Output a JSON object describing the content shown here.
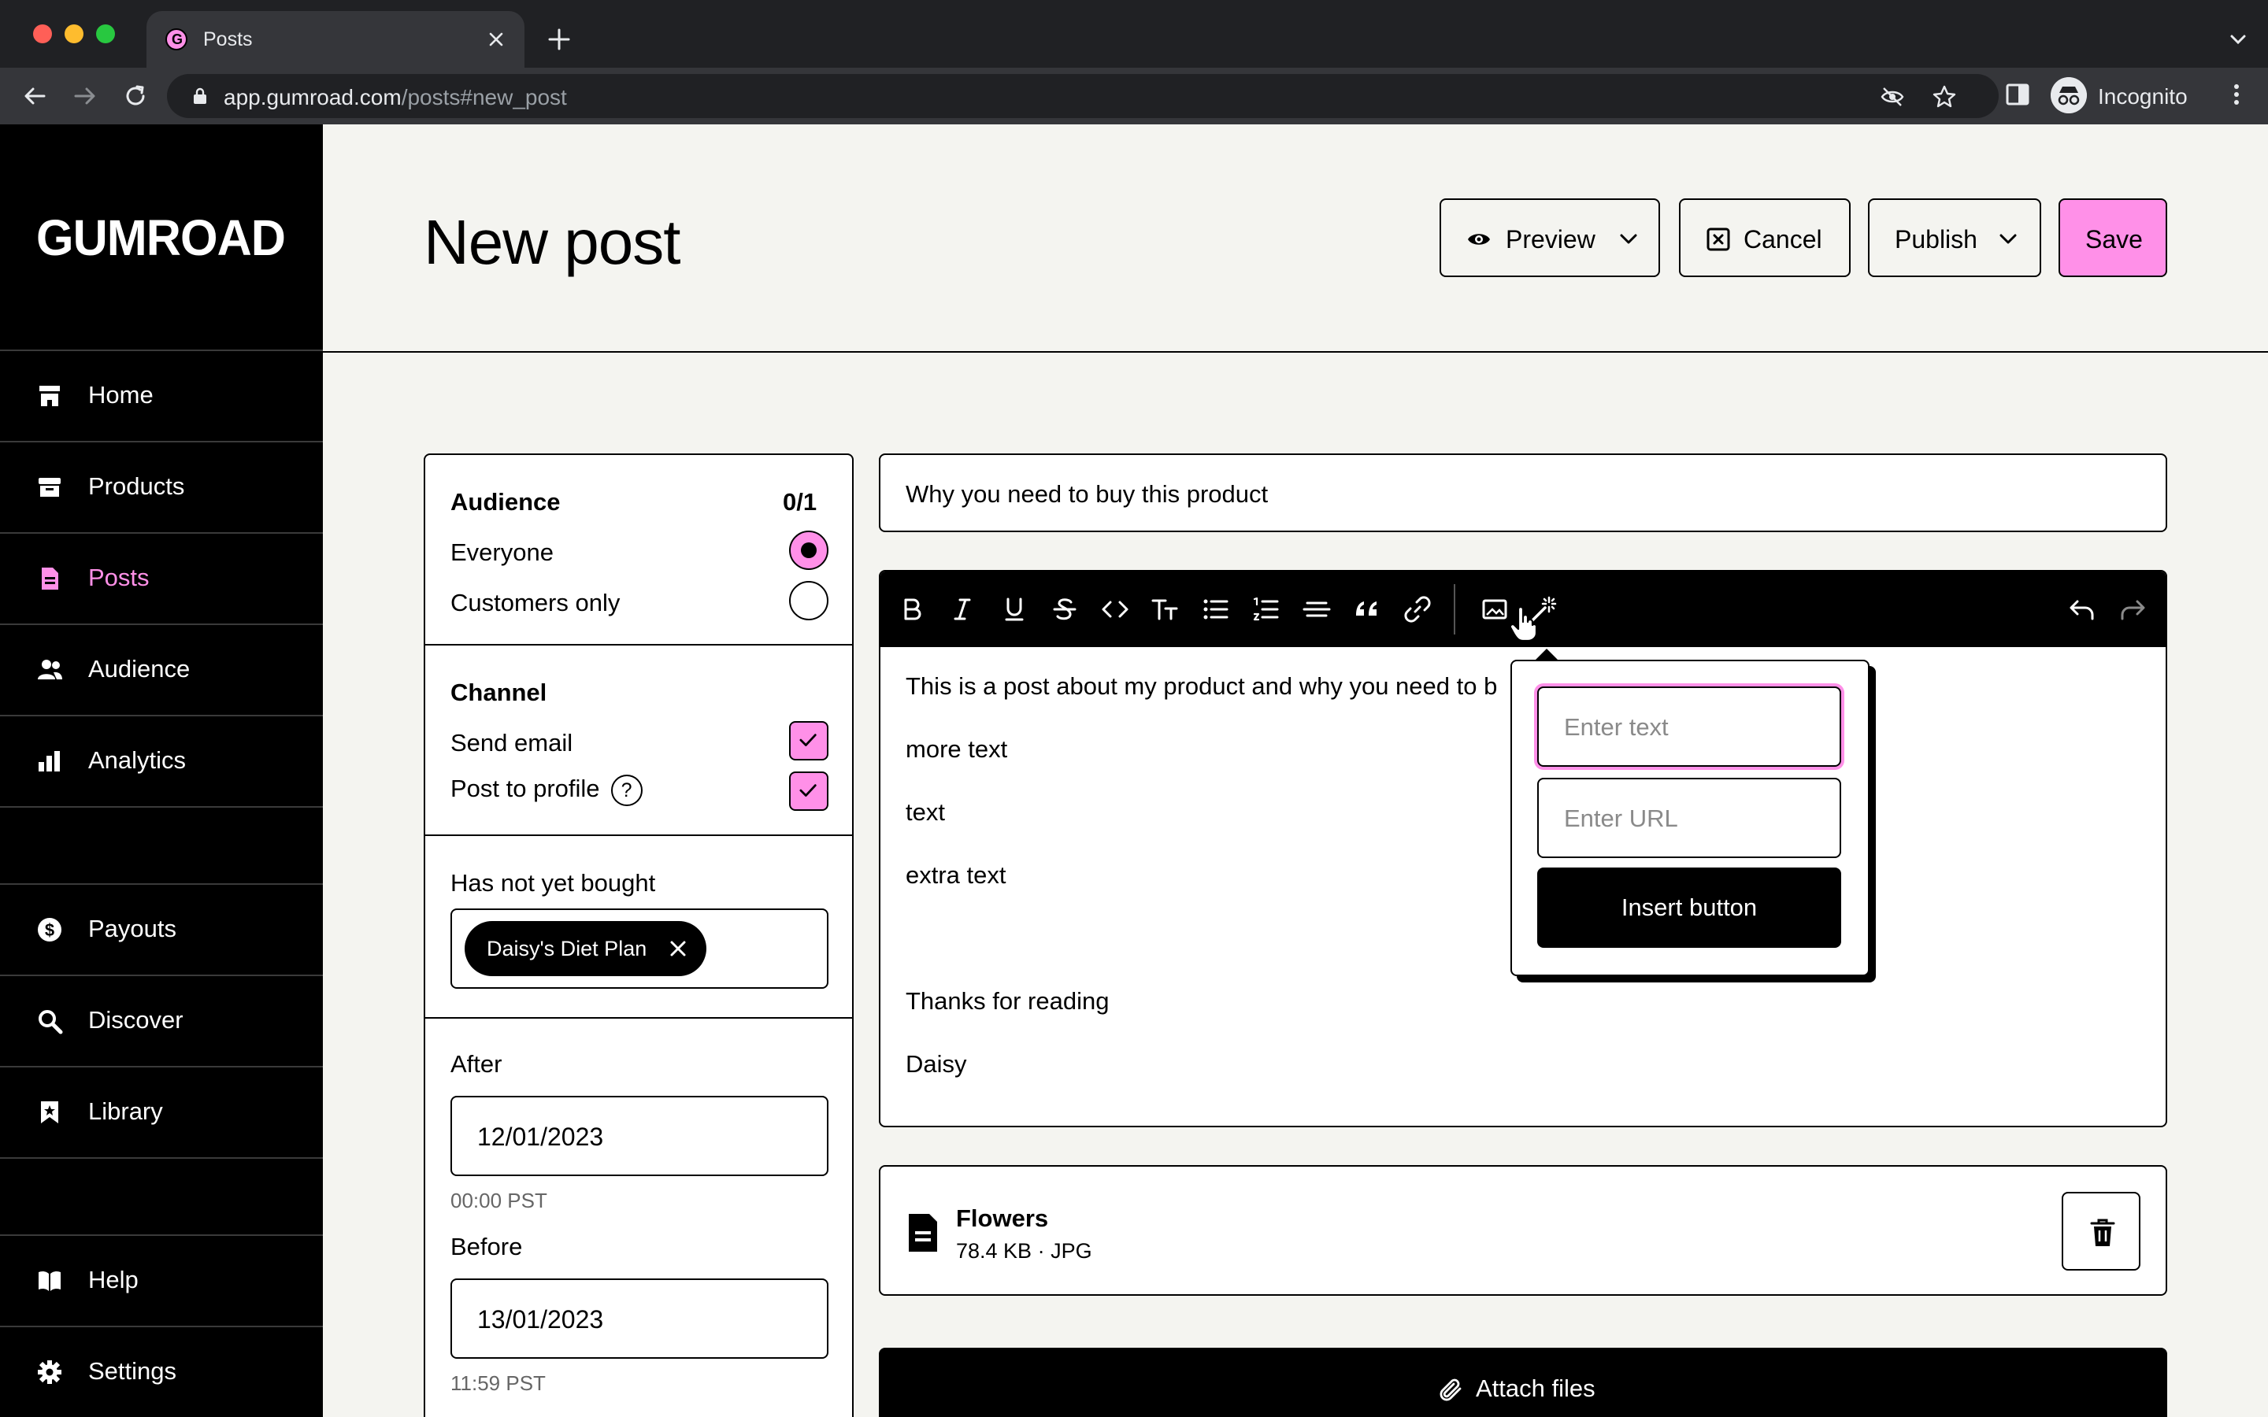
{
  "browser": {
    "tab_title": "Posts",
    "url_domain": "app.gumroad.com",
    "url_path": "/posts#new_post",
    "profile_label": "Incognito"
  },
  "sidebar": {
    "logo": "GUMROAD",
    "items": [
      {
        "label": "Home",
        "icon": "store-icon"
      },
      {
        "label": "Products",
        "icon": "archive-icon"
      },
      {
        "label": "Posts",
        "icon": "document-icon",
        "active": true
      },
      {
        "label": "Audience",
        "icon": "people-icon"
      },
      {
        "label": "Analytics",
        "icon": "bar-chart-icon"
      },
      {
        "label": "Payouts",
        "icon": "dollar-circle-icon"
      },
      {
        "label": "Discover",
        "icon": "search-icon"
      },
      {
        "label": "Library",
        "icon": "bookmark-icon"
      },
      {
        "label": "Help",
        "icon": "book-icon"
      },
      {
        "label": "Settings",
        "icon": "gear-icon"
      }
    ]
  },
  "header": {
    "title": "New post",
    "preview_label": "Preview",
    "cancel_label": "Cancel",
    "publish_label": "Publish",
    "save_label": "Save"
  },
  "settings": {
    "audience_heading": "Audience",
    "audience_count": "0/1",
    "everyone_label": "Everyone",
    "customers_only_label": "Customers only",
    "channel_heading": "Channel",
    "send_email_label": "Send email",
    "post_to_profile_label": "Post to profile",
    "help_glyph": "?",
    "has_not_yet_bought_label": "Has not yet bought",
    "product_tag": "Daisy's Diet Plan",
    "after_label": "After",
    "after_date": "12/01/2023",
    "after_time": "00:00 PST",
    "before_label": "Before",
    "before_date": "13/01/2023",
    "before_time": "11:59 PST"
  },
  "editor": {
    "title_value": "Why you need to buy this product",
    "lines": [
      "This is a post about my product and why you need to b",
      "more text",
      "text",
      "extra text",
      "Thanks for reading",
      "Daisy"
    ]
  },
  "popover": {
    "text_placeholder": "Enter text",
    "url_placeholder": "Enter URL",
    "insert_label": "Insert button"
  },
  "attachment": {
    "name": "Flowers",
    "meta": "78.4 KB · JPG"
  },
  "attach_label": "Attach files",
  "colors": {
    "accent_pink": "#ff90e8",
    "background": "#f4f4f0",
    "sidebar": "#000000"
  }
}
